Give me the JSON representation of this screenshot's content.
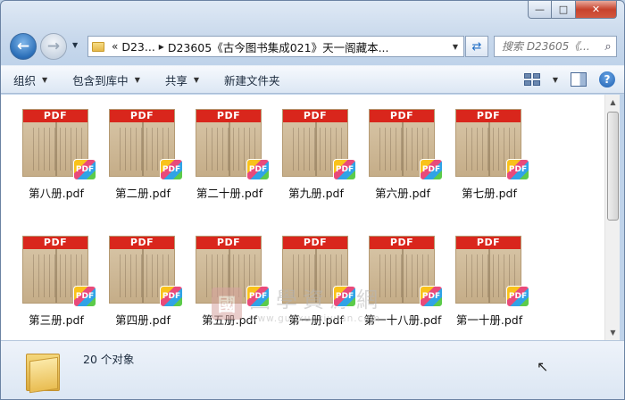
{
  "window": {
    "minimize": "—",
    "maximize": "□",
    "close": "✕"
  },
  "nav": {
    "back_icon": "←",
    "forward_icon": "→",
    "history_icon": "▼"
  },
  "address": {
    "chevron": "«",
    "seg1": "D23...",
    "sep": "▸",
    "seg2": "D23605《古今图书集成021》天一阁藏本...",
    "drop": "▼"
  },
  "refresh_icon": "⇄",
  "search": {
    "placeholder": "搜索 D23605《...",
    "icon": "⌕"
  },
  "toolbar": {
    "organize": "组织",
    "include_library": "包含到库中",
    "share": "共享",
    "new_folder": "新建文件夹",
    "drop": "▼",
    "help": "?"
  },
  "files": [
    {
      "name": "第八册.pdf"
    },
    {
      "name": "第二册.pdf"
    },
    {
      "name": "第二十册.pdf"
    },
    {
      "name": "第九册.pdf"
    },
    {
      "name": "第六册.pdf"
    },
    {
      "name": "第七册.pdf"
    },
    {
      "name": "第三册.pdf"
    },
    {
      "name": "第四册.pdf"
    },
    {
      "name": "第五册.pdf"
    },
    {
      "name": "第一册.pdf"
    },
    {
      "name": "第一十八册.pdf"
    },
    {
      "name": "第一十册.pdf"
    }
  ],
  "pdf_band": "PDF",
  "pdf_badge": "PDF",
  "watermark": {
    "seal": "國",
    "cn": "國學資源網",
    "url": "www.guoxueziyuan.com"
  },
  "scroll": {
    "up": "▲",
    "down": "▼"
  },
  "status": {
    "count": "20 个对象"
  },
  "cursor": "↖"
}
